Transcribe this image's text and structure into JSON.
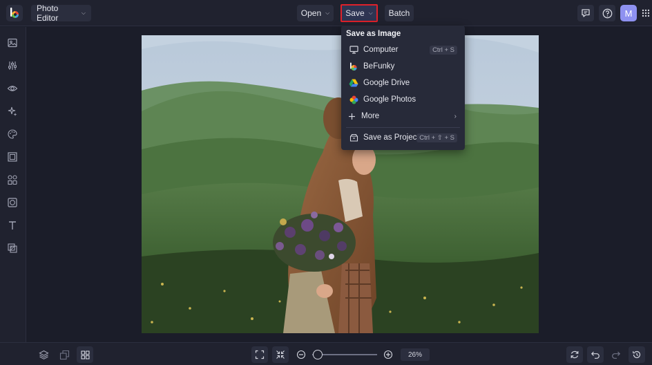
{
  "topbar": {
    "app_menu_label": "Photo Editor",
    "open_label": "Open",
    "save_label": "Save",
    "batch_label": "Batch",
    "avatar_initial": "M"
  },
  "sidebar": {
    "items": [
      "image-icon",
      "adjustments-icon",
      "eye-icon",
      "effects-icon",
      "artsy-icon",
      "frames-icon",
      "graphics-icon",
      "overlays-icon",
      "text-icon",
      "textures-icon"
    ]
  },
  "save_menu": {
    "heading": "Save as Image",
    "items": [
      {
        "label": "Computer",
        "shortcut": "Ctrl + S",
        "icon": "monitor-icon"
      },
      {
        "label": "BeFunky",
        "shortcut": "",
        "icon": "befunky-icon"
      },
      {
        "label": "Google Drive",
        "shortcut": "",
        "icon": "google-drive-icon"
      },
      {
        "label": "Google Photos",
        "shortcut": "",
        "icon": "google-photos-icon"
      },
      {
        "label": "More",
        "shortcut": "",
        "icon": "plus-icon"
      }
    ],
    "project": {
      "label": "Save as Project",
      "shortcut": "Ctrl + ⇧ + S",
      "icon": "project-icon"
    }
  },
  "bottombar": {
    "zoom_value": "26%",
    "zoom_level": 0.26
  },
  "colors": {
    "save_highlight": "#e0212a",
    "avatar": "#8e91f0"
  }
}
